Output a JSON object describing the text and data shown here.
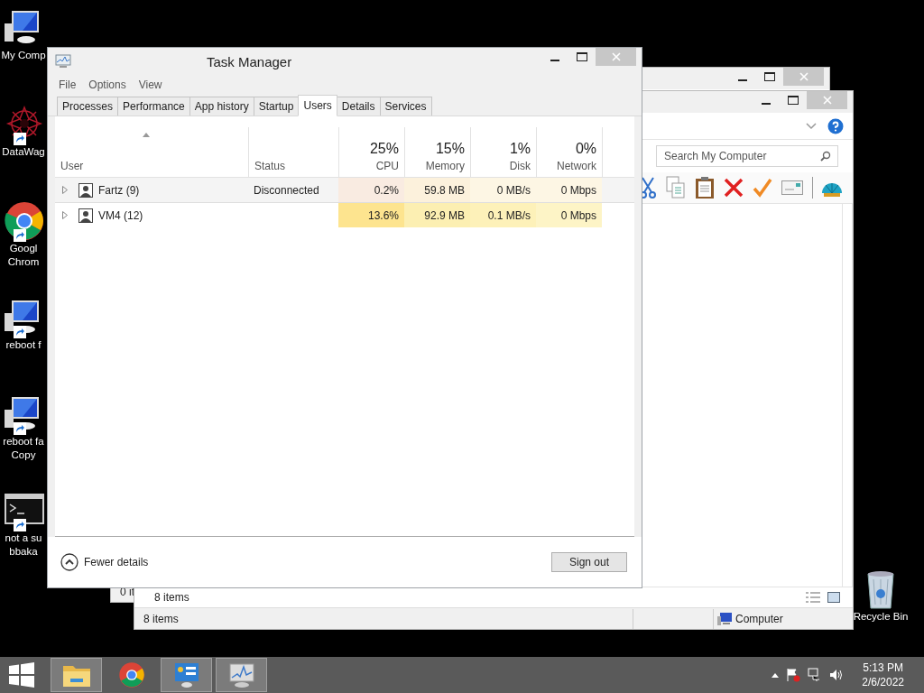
{
  "desktop_icons": [
    {
      "kind": "computer",
      "shortcut": false,
      "lines": [
        "My Comp"
      ]
    },
    {
      "kind": "star",
      "shortcut": true,
      "lines": [
        "DataWag"
      ]
    },
    {
      "kind": "chrome",
      "shortcut": true,
      "lines": [
        "Googl",
        "Chrom"
      ]
    },
    {
      "kind": "computer",
      "shortcut": true,
      "lines": [
        "reboot f"
      ]
    },
    {
      "kind": "computer",
      "shortcut": true,
      "lines": [
        "reboot fa",
        "Copy"
      ]
    },
    {
      "kind": "console",
      "shortcut": true,
      "lines": [
        "not a su",
        "bbaka"
      ]
    }
  ],
  "recycle_bin": {
    "label": "Recycle Bin"
  },
  "back_window": {
    "status": "0 it"
  },
  "explorer_window": {
    "search": {
      "placeholder": "Search My Computer"
    },
    "toolbar": [
      {
        "kind": "cut"
      },
      {
        "kind": "copy"
      },
      {
        "kind": "paste"
      },
      {
        "kind": "delete"
      },
      {
        "kind": "check"
      },
      {
        "kind": "mail"
      },
      {
        "kind": "shell"
      }
    ],
    "pane_status": "8 items",
    "status": "8 items",
    "location": "Computer"
  },
  "task_manager": {
    "title": "Task Manager",
    "menu": [
      "File",
      "Options",
      "View"
    ],
    "tabs": [
      {
        "label": "Processes",
        "selected": false
      },
      {
        "label": "Performance",
        "selected": false
      },
      {
        "label": "App history",
        "selected": false
      },
      {
        "label": "Startup",
        "selected": false
      },
      {
        "label": "Users",
        "selected": true
      },
      {
        "label": "Details",
        "selected": false
      },
      {
        "label": "Services",
        "selected": false
      }
    ],
    "columns": [
      {
        "label": "User",
        "sorted": true
      },
      {
        "label": "Status",
        "sorted": false
      },
      {
        "percent": "25%",
        "label": "CPU",
        "sorted": false
      },
      {
        "percent": "15%",
        "label": "Memory",
        "sorted": false
      },
      {
        "percent": "1%",
        "label": "Disk",
        "sorted": false
      },
      {
        "percent": "0%",
        "label": "Network",
        "sorted": false
      }
    ],
    "rows": [
      {
        "selected": true,
        "cells": [
          {
            "text": "Fartz (9)"
          },
          {
            "text": "Disconnected"
          },
          {
            "text": "0.2%",
            "color": "#f9ebe1"
          },
          {
            "text": "59.8 MB",
            "color": "#fcf1dc"
          },
          {
            "text": "0 MB/s",
            "color": "#fdf6e4"
          },
          {
            "text": "0 Mbps",
            "color": "#fdf6e4"
          }
        ]
      },
      {
        "selected": false,
        "cells": [
          {
            "text": "VM4 (12)"
          },
          {
            "text": ""
          },
          {
            "text": "13.6%",
            "color": "#fde48f"
          },
          {
            "text": "92.9 MB",
            "color": "#fcefb2"
          },
          {
            "text": "0.1 MB/s",
            "color": "#fdf1b9"
          },
          {
            "text": "0 Mbps",
            "color": "#fdf4c6"
          }
        ]
      }
    ],
    "fewer_details": "Fewer details",
    "sign_out": "Sign out"
  },
  "taskbar": {
    "items": [
      {
        "kind": "explorer",
        "open": true
      },
      {
        "kind": "chrome",
        "open": false
      },
      {
        "kind": "control",
        "open": true
      },
      {
        "kind": "monitor",
        "open": true
      }
    ],
    "time": "5:13 PM",
    "date": "2/6/2022"
  }
}
